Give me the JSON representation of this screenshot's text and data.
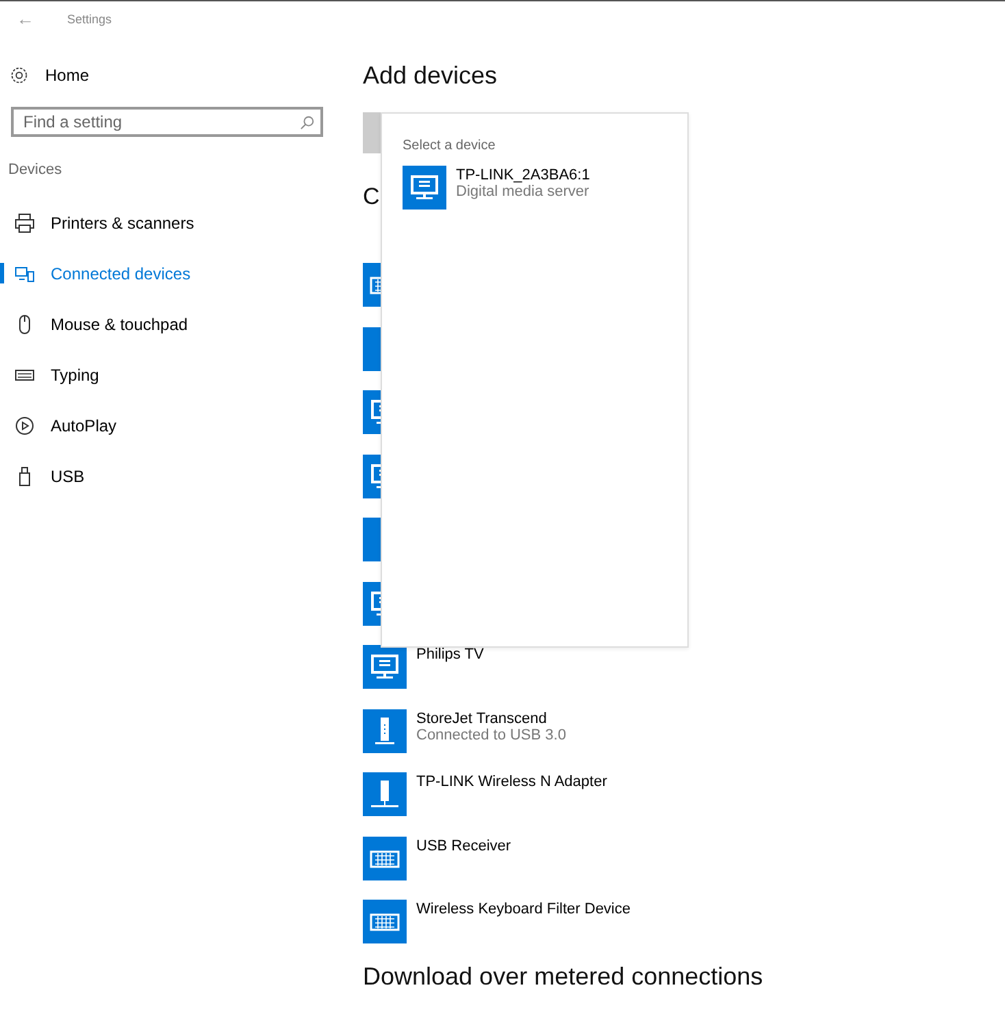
{
  "window": {
    "back": "←",
    "title": "Settings"
  },
  "sidebar": {
    "home": "Home",
    "search": {
      "placeholder": "Find a setting"
    },
    "section": "Devices",
    "items": [
      {
        "label": "Printers & scanners",
        "kind": "printer",
        "selected": false
      },
      {
        "label": "Connected devices",
        "kind": "devices",
        "selected": true
      },
      {
        "label": "Mouse & touchpad",
        "kind": "mouse",
        "selected": false
      },
      {
        "label": "Typing",
        "kind": "keyboard",
        "selected": false
      },
      {
        "label": "AutoPlay",
        "kind": "autoplay",
        "selected": false
      },
      {
        "label": "USB",
        "kind": "usb",
        "selected": false
      }
    ]
  },
  "content": {
    "heading": "Add devices",
    "section_heading": "C",
    "devices": [
      {
        "kind": "keyboard"
      },
      {
        "kind": "generic"
      },
      {
        "kind": "display"
      },
      {
        "kind": "display"
      },
      {
        "kind": "generic"
      },
      {
        "kind": "display"
      },
      {
        "kind": "display",
        "name": "Philips TV"
      },
      {
        "kind": "storage",
        "name": "StoreJet Transcend",
        "status": "Connected to USB 3.0"
      },
      {
        "kind": "adapter",
        "name": "TP-LINK Wireless N Adapter"
      },
      {
        "kind": "keyboard",
        "name": "USB Receiver"
      },
      {
        "kind": "keyboard",
        "name": "Wireless Keyboard Filter Device"
      }
    ],
    "footer_heading": "Download over metered connections"
  },
  "popup": {
    "title": "Select a device",
    "items": [
      {
        "kind": "display",
        "name": "TP-LINK_2A3BA6:1",
        "status": "Digital media server"
      }
    ]
  }
}
